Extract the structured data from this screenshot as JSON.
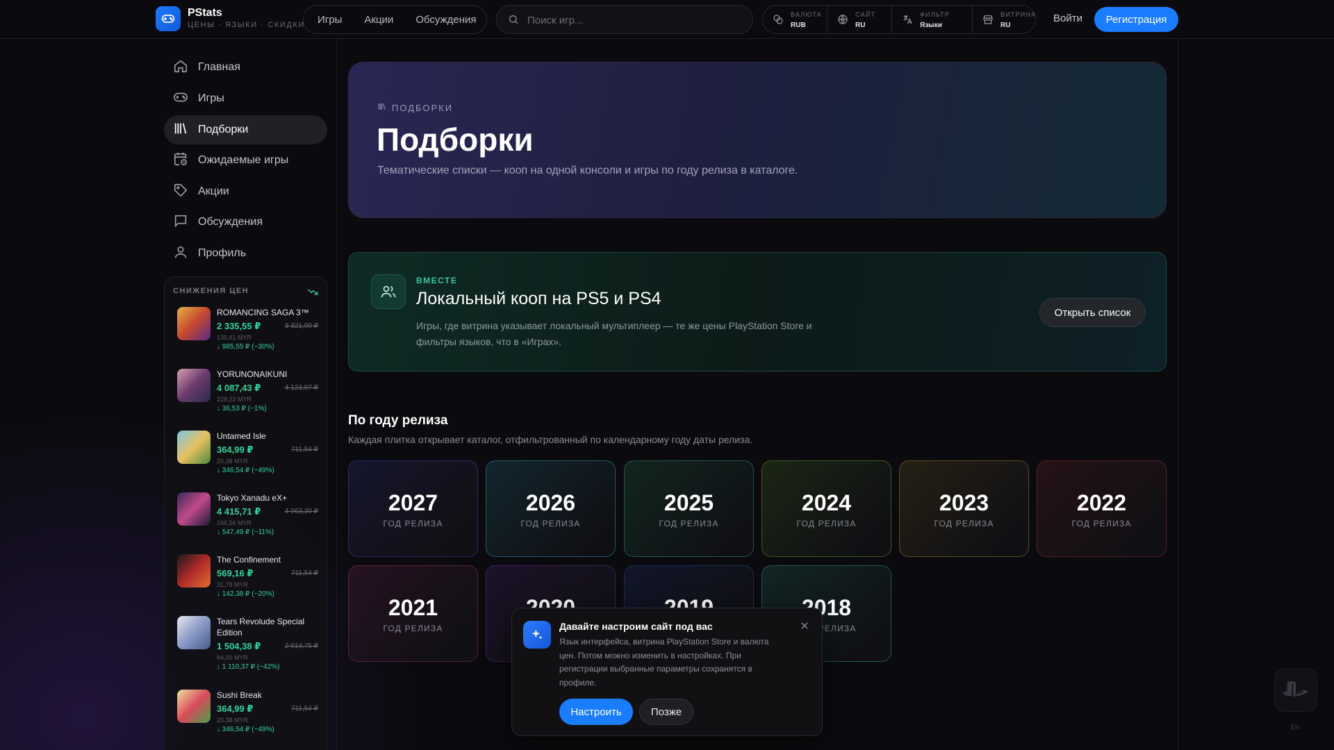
{
  "header": {
    "logo_name": "PStats",
    "logo_tagline": "ЦЕНЫ · ЯЗЫКИ · СКИДКИ",
    "nav": [
      "Игры",
      "Акции",
      "Обсуждения"
    ],
    "search_placeholder": "Поиск игр...",
    "settings": [
      {
        "label": "ВАЛЮТА",
        "value": "RUB",
        "icon": "currency-icon"
      },
      {
        "label": "САЙТ",
        "value": "RU",
        "icon": "globe-icon"
      },
      {
        "label": "ФИЛЬТР",
        "value": "Языки",
        "icon": "translate-icon"
      },
      {
        "label": "ВИТРИНА",
        "value": "RU",
        "icon": "store-icon"
      }
    ],
    "login": "Войти",
    "register": "Регистрация"
  },
  "sidebar": {
    "items": [
      {
        "label": "Главная",
        "icon": "home-icon"
      },
      {
        "label": "Игры",
        "icon": "gamepad-icon"
      },
      {
        "label": "Подборки",
        "icon": "library-icon",
        "active": true
      },
      {
        "label": "Ожидаемые игры",
        "icon": "calendar-clock-icon"
      },
      {
        "label": "Акции",
        "icon": "tag-icon"
      },
      {
        "label": "Обсуждения",
        "icon": "chat-icon"
      },
      {
        "label": "Профиль",
        "icon": "user-icon"
      }
    ],
    "drops_title": "СНИЖЕНИЯ ЦЕН",
    "drops": [
      {
        "name": "ROMANCING SAGA 3™",
        "price": "2 335,55 ₽",
        "old": "3 321,09 ₽",
        "myr": "130,41 MYR",
        "diff": "↓ 985,55 ₽ (−30%)"
      },
      {
        "name": "YORUNONAIKUNI",
        "price": "4 087,43 ₽",
        "old": "4 123,97 ₽",
        "myr": "228,23 MYR",
        "diff": "↓ 36,53 ₽ (−1%)"
      },
      {
        "name": "Untamed Isle",
        "price": "364,99 ₽",
        "old": "711,54 ₽",
        "myr": "20,38 MYR",
        "diff": "↓ 346,54 ₽ (−49%)"
      },
      {
        "name": "Tokyo Xanadu eX+",
        "price": "4 415,71 ₽",
        "old": "4 963,20 ₽",
        "myr": "246,56 MYR",
        "diff": "↓ 547,49 ₽ (−11%)"
      },
      {
        "name": "The Confinement",
        "price": "569,16 ₽",
        "old": "711,54 ₽",
        "myr": "31,78 MYR",
        "diff": "↓ 142,38 ₽ (−20%)"
      },
      {
        "name": "Tears Revolude Special Edition",
        "price": "1 504,38 ₽",
        "old": "2 614,75 ₽",
        "myr": "84,00 MYR",
        "diff": "↓ 1 110,37 ₽ (−42%)"
      },
      {
        "name": "Sushi Break",
        "price": "364,99 ₽",
        "old": "711,54 ₽",
        "myr": "20,38 MYR",
        "diff": "↓ 346,54 ₽ (−49%)"
      }
    ]
  },
  "hero": {
    "kicker": "ПОДБОРКИ",
    "title": "Подборки",
    "subtitle": "Тематические списки — кооп на одной консоли и игры по году релиза в каталоге."
  },
  "coop": {
    "kicker": "ВМЕСТЕ",
    "title": "Локальный кооп на PS5 и PS4",
    "desc": "Игры, где витрина указывает локальный мультиплеер — те же цены PlayStation Store и фильтры языков, что в «Играх».",
    "button": "Открыть список"
  },
  "years": {
    "title": "По году релиза",
    "subtitle": "Каждая плитка открывает каталог, отфильтрованный по календарному году даты релиза.",
    "label": "ГОД РЕЛИЗА",
    "items": [
      {
        "year": "2027",
        "color": "#2a2a6a"
      },
      {
        "year": "2026",
        "color": "#1f5a6a"
      },
      {
        "year": "2025",
        "color": "#1f5a40"
      },
      {
        "year": "2024",
        "color": "#3c5a1f"
      },
      {
        "year": "2023",
        "color": "#5a4a1f"
      },
      {
        "year": "2022",
        "color": "#5a1f24"
      },
      {
        "year": "2021",
        "color": "#5a1f44"
      },
      {
        "year": "2020",
        "color": "#3c1f5a"
      },
      {
        "year": "2019",
        "color": "#1f2a5a"
      },
      {
        "year": "2018",
        "color": "#1f5a50"
      }
    ]
  },
  "popup": {
    "title": "Давайте настроим сайт под вас",
    "text": "Язык интерфейса, витрина PlayStation Store и валюта цен. Потом можно изменить в настройках. При регистрации выбранные параметры сохранятся в профиле.",
    "primary": "Настроить",
    "secondary": "Позже"
  },
  "badge_lang": "EN"
}
